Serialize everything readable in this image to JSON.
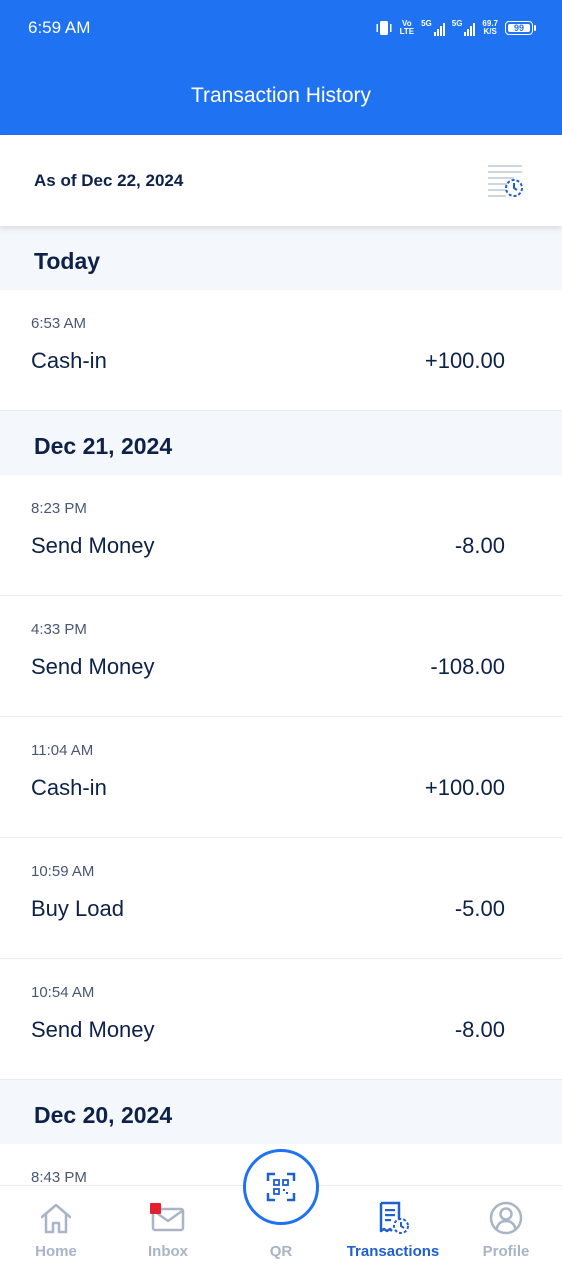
{
  "status_bar": {
    "time": "6:59 AM",
    "volte_top": "Vo",
    "volte_bottom": "LTE",
    "network_1": "5G",
    "network_2": "5G",
    "speed_value": "69.7",
    "speed_unit": "K/S",
    "battery": "99"
  },
  "header": {
    "title": "Transaction History"
  },
  "as_of": {
    "text": "As of Dec 22, 2024",
    "icon": "history-filter-icon"
  },
  "sections": [
    {
      "label": "Today",
      "transactions": [
        {
          "time": "6:53 AM",
          "name": "Cash-in",
          "amount": "+100.00"
        }
      ]
    },
    {
      "label": "Dec 21, 2024",
      "transactions": [
        {
          "time": "8:23 PM",
          "name": "Send Money",
          "amount": "-8.00"
        },
        {
          "time": "4:33 PM",
          "name": "Send Money",
          "amount": "-108.00"
        },
        {
          "time": "11:04 AM",
          "name": "Cash-in",
          "amount": "+100.00"
        },
        {
          "time": "10:59 AM",
          "name": "Buy Load",
          "amount": "-5.00"
        },
        {
          "time": "10:54 AM",
          "name": "Send Money",
          "amount": "-8.00"
        }
      ]
    },
    {
      "label": "Dec 20, 2024",
      "transactions": [
        {
          "time": "8:43 PM",
          "name": "",
          "amount": ""
        }
      ]
    }
  ],
  "nav": {
    "items": [
      {
        "label": "Home",
        "icon": "home-icon"
      },
      {
        "label": "Inbox",
        "icon": "mail-icon"
      },
      {
        "label": "QR",
        "icon": "qr-scan-icon"
      },
      {
        "label": "Transactions",
        "icon": "receipt-clock-icon"
      },
      {
        "label": "Profile",
        "icon": "user-circle-icon"
      }
    ],
    "active": "Transactions"
  },
  "colors": {
    "brand_blue": "#1f72f2",
    "text_navy": "#0d2149",
    "section_bg": "#f4f7fb",
    "nav_inactive": "#a9b4c6",
    "inbox_badge": "#e5202e"
  }
}
